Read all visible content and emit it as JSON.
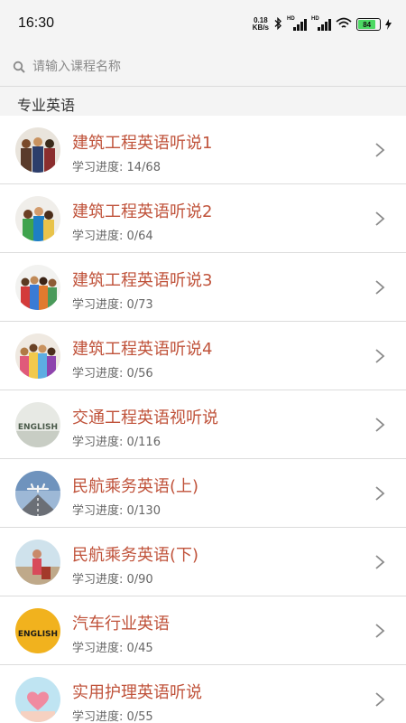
{
  "status_bar": {
    "time": "16:30",
    "net_speed_value": "0.18",
    "net_speed_unit": "KB/s",
    "signal_label": "HD",
    "battery_level": "84"
  },
  "search": {
    "placeholder": "请输入课程名称"
  },
  "section": {
    "title": "专业英语"
  },
  "courses": [
    {
      "title": "建筑工程英语听说1",
      "progress": "学习进度: 14/68",
      "thumb_icon": "group-photo-icon"
    },
    {
      "title": "建筑工程英语听说2",
      "progress": "学习进度: 0/64",
      "thumb_icon": "group-photo-icon"
    },
    {
      "title": "建筑工程英语听说3",
      "progress": "学习进度: 0/73",
      "thumb_icon": "group-photo-icon"
    },
    {
      "title": "建筑工程英语听说4",
      "progress": "学习进度: 0/56",
      "thumb_icon": "group-photo-icon"
    },
    {
      "title": "交通工程英语视听说",
      "progress": "学习进度: 0/116",
      "thumb_icon": "english-text-icon",
      "thumb_text": "ENGLISH"
    },
    {
      "title": "民航乘务英语(上)",
      "progress": "学习进度: 0/130",
      "thumb_icon": "airplane-runway-icon"
    },
    {
      "title": "民航乘务英语(下)",
      "progress": "学习进度: 0/90",
      "thumb_icon": "flight-attendant-icon"
    },
    {
      "title": "汽车行业英语",
      "progress": "学习进度: 0/45",
      "thumb_icon": "industry-english-icon",
      "thumb_text": "ENGLISH"
    },
    {
      "title": "实用护理英语听说",
      "progress": "学习进度: 0/55",
      "thumb_icon": "heart-hands-icon"
    }
  ],
  "colors": {
    "title_accent": "#c0533b",
    "battery_green": "#4cd964"
  }
}
